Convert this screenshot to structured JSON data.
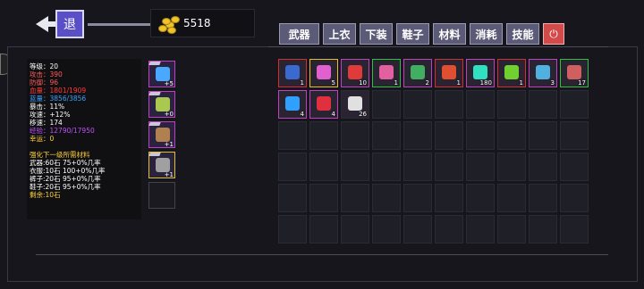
{
  "header": {
    "back_label": "退",
    "gold": "5518"
  },
  "tabs": [
    "武器",
    "上衣",
    "下装",
    "鞋子",
    "材料",
    "消耗",
    "技能"
  ],
  "stats": [
    {
      "text": "等级：20",
      "color": "#ffffff"
    },
    {
      "text": "攻击：390",
      "color": "#ff5a5a"
    },
    {
      "text": "防御：96",
      "color": "#ff5a5a"
    },
    {
      "text": "血量：1801/1909",
      "color": "#ff3a3a"
    },
    {
      "text": "蓝量：3856/3856",
      "color": "#3aa0ff"
    },
    {
      "text": "暴击：11%",
      "color": "#ffffff"
    },
    {
      "text": "攻速：+12%",
      "color": "#ffffff"
    },
    {
      "text": "移速：174",
      "color": "#ffffff"
    },
    {
      "text": "经验：12790/17950",
      "color": "#c050ff"
    },
    {
      "text": "幸运：0",
      "color": "#ffd23a"
    },
    {
      "text": "",
      "color": "#ffffff"
    },
    {
      "text": "强化下一级所需材料",
      "color": "#ffd23a"
    },
    {
      "text": "武器:60石 75+0%几率",
      "color": "#ffffff"
    },
    {
      "text": "衣服:10石 100+0%几率",
      "color": "#ffffff"
    },
    {
      "text": "裤子:20石 95+0%几率",
      "color": "#ffffff"
    },
    {
      "text": "鞋子:20石 95+0%几率",
      "color": "#ffffff"
    },
    {
      "text": "剩余:10石",
      "color": "#ffd23a"
    }
  ],
  "equipment": [
    {
      "slot": "weapon",
      "count": "+5",
      "color": "#4aa8ff"
    },
    {
      "slot": "top",
      "count": "+0",
      "color": "#a8c850"
    },
    {
      "slot": "bottom",
      "count": "+1",
      "color": "#b08050"
    },
    {
      "slot": "shoes",
      "count": "+1",
      "color": "#a0a0a0"
    },
    {
      "slot": "empty",
      "count": "",
      "color": ""
    }
  ],
  "inventory": [
    {
      "count": "1",
      "color": "#3a6ad0",
      "border": "#d03030"
    },
    {
      "count": "5",
      "color": "#e060d0",
      "border": "#e0c030"
    },
    {
      "count": "10",
      "color": "#e03a3a",
      "border": "#c040c0"
    },
    {
      "count": "1",
      "color": "#e060a0",
      "border": "#30c040"
    },
    {
      "count": "2",
      "color": "#40b060",
      "border": "#c040c0"
    },
    {
      "count": "1",
      "color": "#e05030",
      "border": "#d03030"
    },
    {
      "count": "180",
      "color": "#30e0c0",
      "border": "#c040c0"
    },
    {
      "count": "1",
      "color": "#70d030",
      "border": "#d03030"
    },
    {
      "count": "3",
      "color": "#50b0e0",
      "border": "#c040c0"
    },
    {
      "count": "17",
      "color": "#d06060",
      "border": "#30c040"
    },
    {
      "count": "4",
      "color": "#30a0ff",
      "border": "#c040c0"
    },
    {
      "count": "4",
      "color": "#e03040",
      "border": "#c040c0"
    },
    {
      "count": "26",
      "color": "#e0e0e0",
      "border": "#2b2b36"
    }
  ]
}
